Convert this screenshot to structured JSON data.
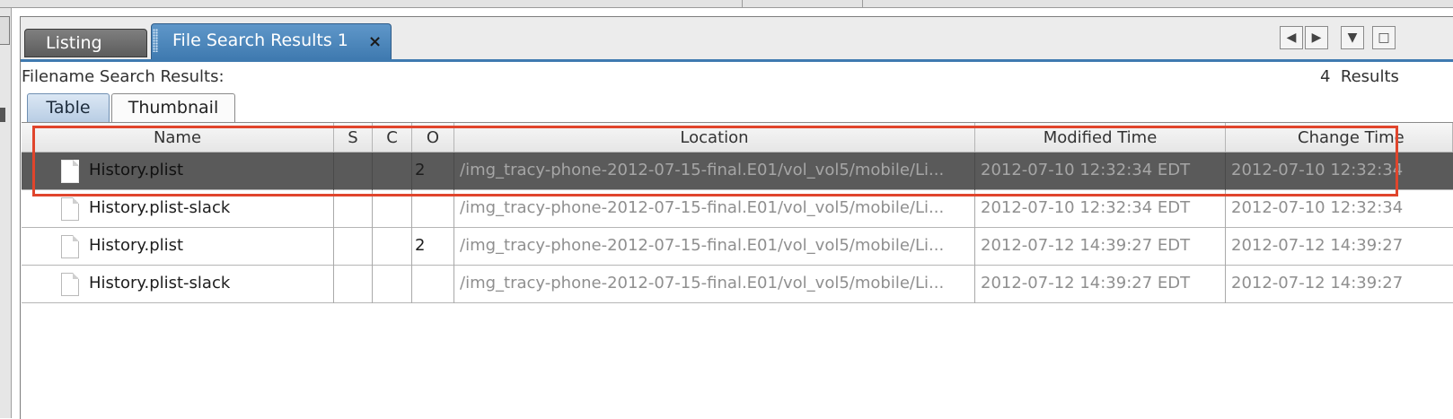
{
  "tabs": {
    "listing": "Listing",
    "results": "File Search Results 1",
    "close_glyph": "×"
  },
  "nav": {
    "prev": "◀",
    "next": "▶",
    "menu": "▼",
    "maximize": "□"
  },
  "header": {
    "label": "Filename Search Results:",
    "count": "4  Results"
  },
  "subtabs": {
    "table": "Table",
    "thumbnail": "Thumbnail"
  },
  "columns": [
    "Name",
    "S",
    "C",
    "O",
    "Location",
    "Modified Time",
    "Change Time"
  ],
  "rows": [
    {
      "name": "History.plist",
      "s": "",
      "c": "",
      "o": "2",
      "location": "/img_tracy-phone-2012-07-15-final.E01/vol_vol5/mobile/Li...",
      "modified": "2012-07-10 12:32:34 EDT",
      "changed": "2012-07-10 12:32:34",
      "selected": true
    },
    {
      "name": "History.plist-slack",
      "s": "",
      "c": "",
      "o": "",
      "location": "/img_tracy-phone-2012-07-15-final.E01/vol_vol5/mobile/Li...",
      "modified": "2012-07-10 12:32:34 EDT",
      "changed": "2012-07-10 12:32:34",
      "selected": false
    },
    {
      "name": "History.plist",
      "s": "",
      "c": "",
      "o": "2",
      "location": "/img_tracy-phone-2012-07-15-final.E01/vol_vol5/mobile/Li...",
      "modified": "2012-07-12 14:39:27 EDT",
      "changed": "2012-07-12 14:39:27",
      "selected": false
    },
    {
      "name": "History.plist-slack",
      "s": "",
      "c": "",
      "o": "",
      "location": "/img_tracy-phone-2012-07-15-final.E01/vol_vol5/mobile/Li...",
      "modified": "2012-07-12 14:39:27 EDT",
      "changed": "2012-07-12 14:39:27",
      "selected": false
    }
  ],
  "colors": {
    "active_tab": "#3f7ab0",
    "selected_row": "#5a5a5a",
    "annotation": "#e0452c"
  }
}
